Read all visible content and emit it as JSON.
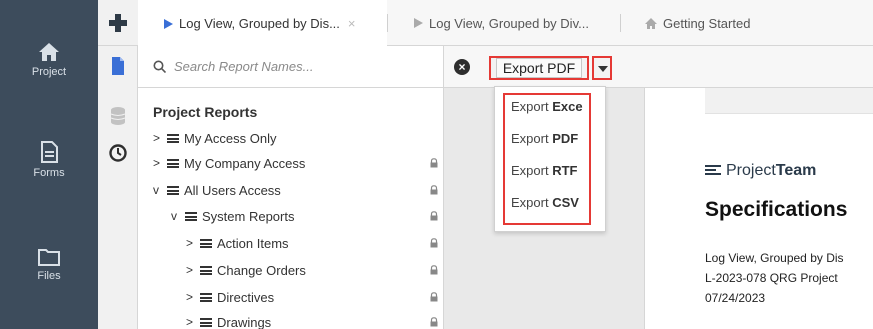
{
  "nav": {
    "items": [
      {
        "label": "Project",
        "icon": "home-icon"
      },
      {
        "label": "Forms",
        "icon": "document-icon"
      },
      {
        "label": "Files",
        "icon": "folder-icon"
      }
    ]
  },
  "tabs": [
    {
      "label": "Log View, Grouped by Dis...",
      "close": "×"
    },
    {
      "label": "Log View, Grouped by Div..."
    },
    {
      "label": "Getting Started"
    }
  ],
  "search": {
    "placeholder": "Search Report Names..."
  },
  "reports": {
    "title": "Project Reports",
    "items": [
      {
        "label": "My Access Only",
        "chev": ">",
        "locked": false
      },
      {
        "label": "My Company Access",
        "chev": ">",
        "locked": true
      },
      {
        "label": "All Users Access",
        "chev": "v",
        "locked": true
      },
      {
        "label": "System Reports",
        "chev": "v",
        "locked": true
      },
      {
        "label": "Action Items",
        "chev": ">",
        "locked": true
      },
      {
        "label": "Change Orders",
        "chev": ">",
        "locked": true
      },
      {
        "label": "Directives",
        "chev": ">",
        "locked": true
      },
      {
        "label": "Drawings",
        "chev": ">",
        "locked": true
      }
    ]
  },
  "toolbar": {
    "export_label": "Export PDF"
  },
  "export_menu": {
    "items": [
      {
        "prefix": "Export ",
        "format": "Exce"
      },
      {
        "prefix": "Export ",
        "format": "PDF"
      },
      {
        "prefix": "Export ",
        "format": "RTF"
      },
      {
        "prefix": "Export ",
        "format": "CSV"
      }
    ]
  },
  "document": {
    "logo_light": "Project",
    "logo_bold": "Team",
    "title": "Specifications",
    "lines": [
      "Log View, Grouped by Dis",
      "L-2023-078 QRG Project",
      "07/24/2023"
    ]
  },
  "colors": {
    "nav_bg": "#3d4c5c",
    "highlight": "#e53935",
    "tab_active_marker": "#3a6fd6"
  }
}
